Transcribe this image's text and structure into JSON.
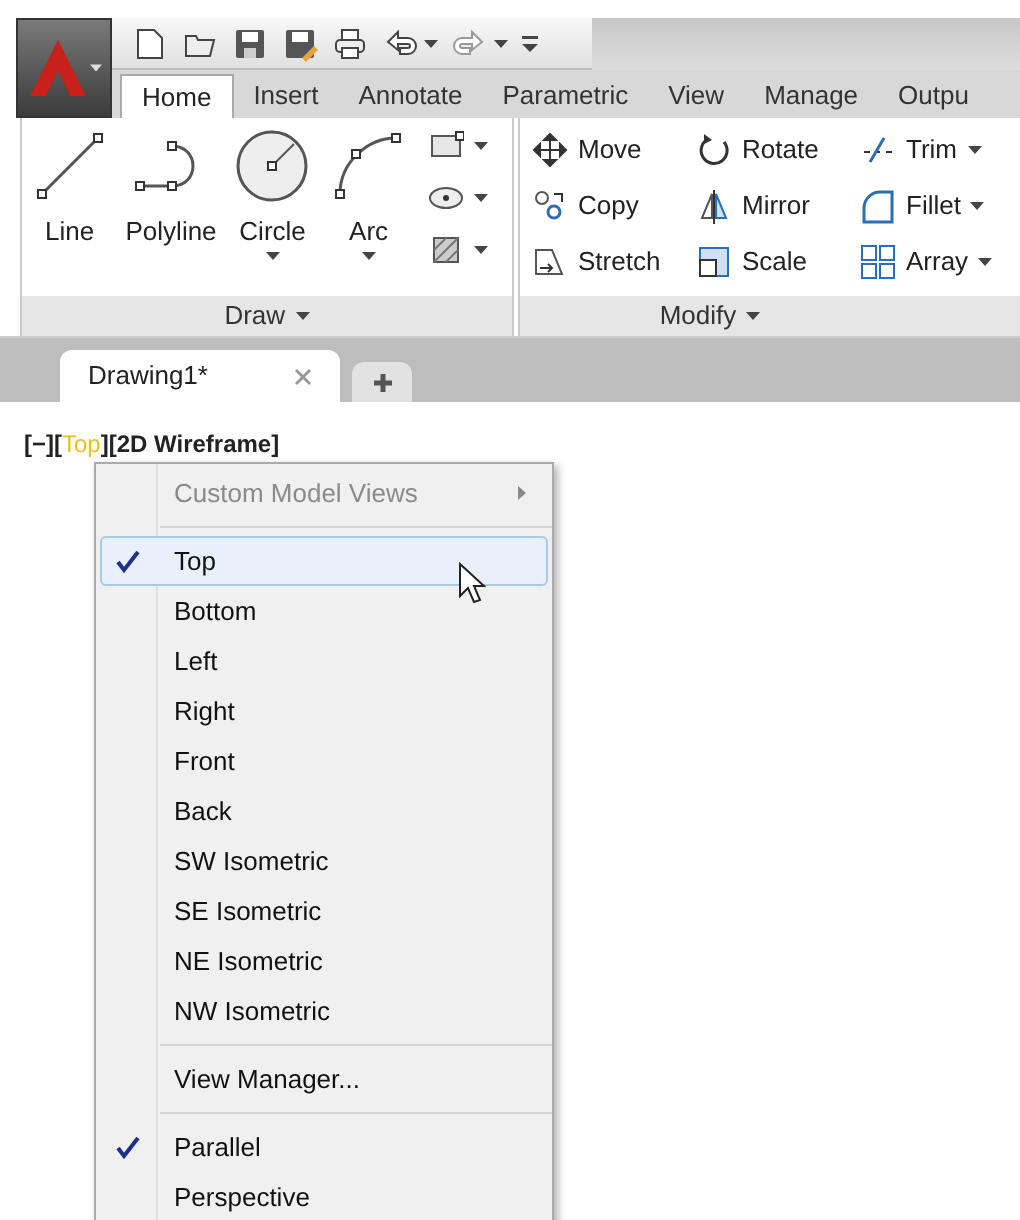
{
  "quick_access": {
    "tools": [
      {
        "kind": "new"
      },
      {
        "kind": "open"
      },
      {
        "kind": "save"
      },
      {
        "kind": "saveas"
      },
      {
        "kind": "print"
      },
      {
        "kind": "undo"
      },
      {
        "kind": "redo"
      },
      {
        "kind": "customize"
      }
    ]
  },
  "ribbon_tabs": [
    {
      "label": "Home",
      "selected": true
    },
    {
      "label": "Insert",
      "selected": false
    },
    {
      "label": "Annotate",
      "selected": false
    },
    {
      "label": "Parametric",
      "selected": false
    },
    {
      "label": "View",
      "selected": false
    },
    {
      "label": "Manage",
      "selected": false
    },
    {
      "label": "Outpu",
      "selected": false
    }
  ],
  "draw_panel": {
    "title": "Draw",
    "large_tools": [
      {
        "kind": "line",
        "label": "Line",
        "dropdown": false
      },
      {
        "kind": "polyline",
        "label": "Polyline",
        "dropdown": false
      },
      {
        "kind": "circle",
        "label": "Circle",
        "dropdown": true
      },
      {
        "kind": "arc",
        "label": "Arc",
        "dropdown": true
      }
    ],
    "small_tools": [
      {
        "kind": "rectangle"
      },
      {
        "kind": "ellipse"
      },
      {
        "kind": "hatch"
      }
    ]
  },
  "modify_panel": {
    "title": "Modify",
    "tools": [
      {
        "kind": "move",
        "label": "Move",
        "dropdown": false
      },
      {
        "kind": "rotate",
        "label": "Rotate",
        "dropdown": false
      },
      {
        "kind": "trim",
        "label": "Trim",
        "dropdown": true
      },
      {
        "kind": "copy",
        "label": "Copy",
        "dropdown": false
      },
      {
        "kind": "mirror",
        "label": "Mirror",
        "dropdown": false
      },
      {
        "kind": "fillet",
        "label": "Fillet",
        "dropdown": true
      },
      {
        "kind": "stretch",
        "label": "Stretch",
        "dropdown": false
      },
      {
        "kind": "scale",
        "label": "Scale",
        "dropdown": false
      },
      {
        "kind": "array",
        "label": "Array",
        "dropdown": true
      }
    ]
  },
  "file_tabs": [
    {
      "label": "Drawing1*",
      "selected": true
    }
  ],
  "viewport_controls": [
    {
      "text": "[−][",
      "highlighted": false
    },
    {
      "text": "Top",
      "highlighted": true
    },
    {
      "text": "][2D Wireframe]",
      "highlighted": false
    }
  ],
  "context_menu": {
    "groups": [
      [
        {
          "kind": "submenu",
          "label": "Custom Model Views",
          "disabled": true,
          "checked": false,
          "selected": false
        }
      ],
      [
        {
          "kind": "item",
          "label": "Top",
          "disabled": false,
          "checked": true,
          "selected": true
        },
        {
          "kind": "item",
          "label": "Bottom",
          "disabled": false,
          "checked": false,
          "selected": false
        },
        {
          "kind": "item",
          "label": "Left",
          "disabled": false,
          "checked": false,
          "selected": false
        },
        {
          "kind": "item",
          "label": "Right",
          "disabled": false,
          "checked": false,
          "selected": false
        },
        {
          "kind": "item",
          "label": "Front",
          "disabled": false,
          "checked": false,
          "selected": false
        },
        {
          "kind": "item",
          "label": "Back",
          "disabled": false,
          "checked": false,
          "selected": false
        },
        {
          "kind": "item",
          "label": "SW Isometric",
          "disabled": false,
          "checked": false,
          "selected": false
        },
        {
          "kind": "item",
          "label": "SE Isometric",
          "disabled": false,
          "checked": false,
          "selected": false
        },
        {
          "kind": "item",
          "label": "NE Isometric",
          "disabled": false,
          "checked": false,
          "selected": false
        },
        {
          "kind": "item",
          "label": "NW Isometric",
          "disabled": false,
          "checked": false,
          "selected": false
        }
      ],
      [
        {
          "kind": "item",
          "label": "View Manager...",
          "disabled": false,
          "checked": false,
          "selected": false
        }
      ],
      [
        {
          "kind": "item",
          "label": "Parallel",
          "disabled": false,
          "checked": true,
          "selected": false
        },
        {
          "kind": "item",
          "label": "Perspective",
          "disabled": false,
          "checked": false,
          "selected": false
        }
      ]
    ]
  }
}
